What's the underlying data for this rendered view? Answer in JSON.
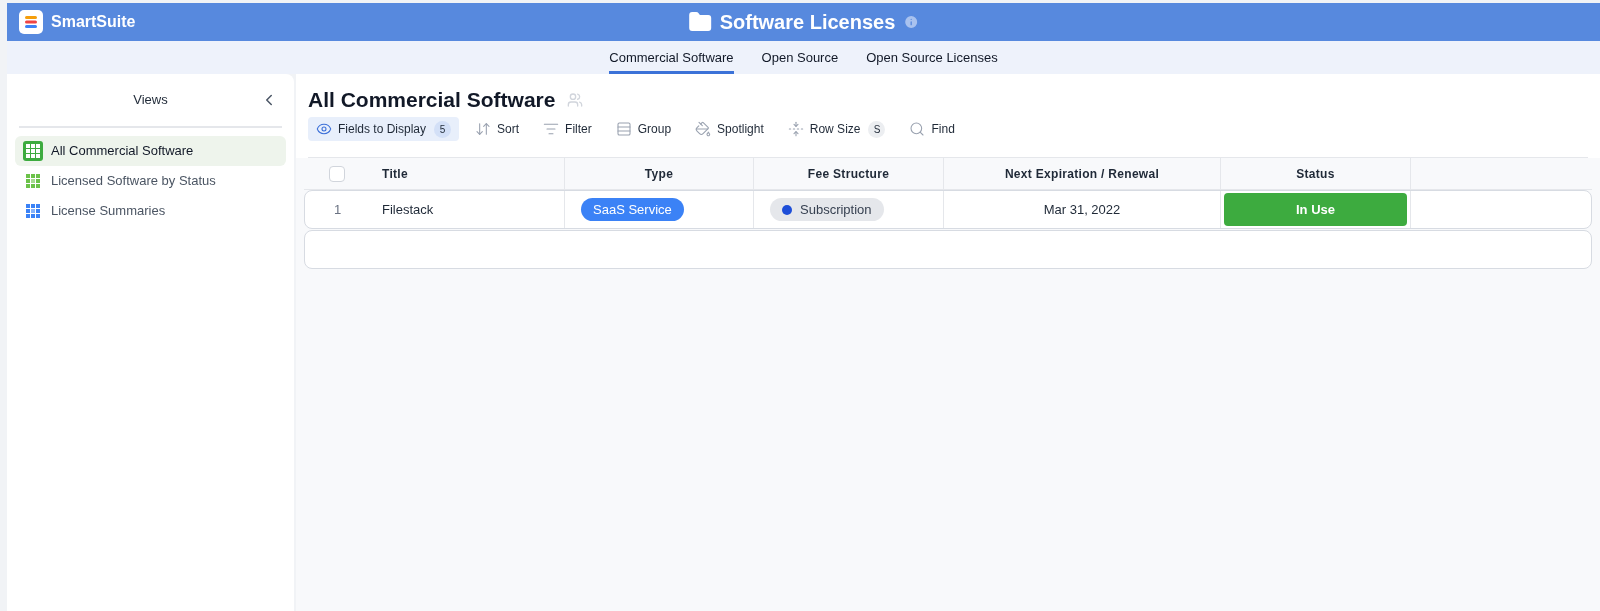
{
  "app": {
    "name": "SmartSuite"
  },
  "solution": {
    "title": "Software Licenses"
  },
  "tabs": [
    {
      "label": "Commercial Software",
      "selected": true
    },
    {
      "label": "Open Source",
      "selected": false
    },
    {
      "label": "Open Source Licenses",
      "selected": false
    }
  ],
  "sidebar": {
    "title": "Views",
    "items": [
      {
        "label": "All Commercial Software",
        "selected": true,
        "kind": "grid"
      },
      {
        "label": "Licensed Software by Status",
        "selected": false,
        "kind": "kanban"
      },
      {
        "label": "License Summaries",
        "selected": false,
        "kind": "summary"
      }
    ]
  },
  "view": {
    "title": "All Commercial Software"
  },
  "toolbar": [
    {
      "label": "Fields to Display",
      "kind": "fields",
      "badge": "5",
      "selected": true
    },
    {
      "label": "Sort",
      "kind": "sort",
      "selected": false
    },
    {
      "label": "Filter",
      "kind": "filter",
      "selected": false
    },
    {
      "label": "Group",
      "kind": "group",
      "selected": false
    },
    {
      "label": "Spotlight",
      "kind": "spotlight",
      "selected": false
    },
    {
      "label": "Row Size",
      "kind": "rowsize",
      "badge": "S",
      "selected": false
    },
    {
      "label": "Find",
      "kind": "find",
      "selected": false
    }
  ],
  "table": {
    "columns": [
      "Title",
      "Type",
      "Fee Structure",
      "Next Expiration / Renewal",
      "Status"
    ],
    "select_all": {
      "checked": false
    },
    "rows": [
      {
        "number": "1",
        "title": "Filestack",
        "type": {
          "label": "SaaS Service",
          "color": "#3b82f6"
        },
        "fee": {
          "label": "Subscription",
          "color": "#1d4ed8"
        },
        "next": "Mar 31, 2022",
        "status": {
          "label": "In Use",
          "color": "#3dab3f"
        }
      }
    ]
  }
}
